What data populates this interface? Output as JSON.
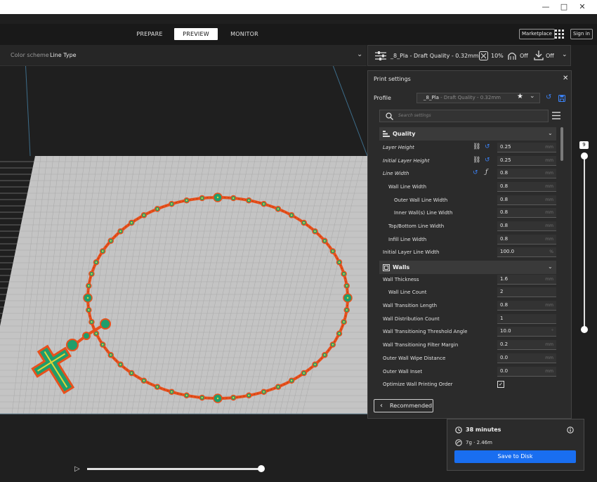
{
  "window": {
    "minimize": "—",
    "maximize": "□",
    "close": "✕"
  },
  "stages": [
    {
      "label": "PREPARE",
      "active": false
    },
    {
      "label": "PREVIEW",
      "active": true
    },
    {
      "label": "MONITOR",
      "active": false
    }
  ],
  "header": {
    "marketplace": "Marketplace",
    "signin": "Sign in"
  },
  "color_scheme": {
    "label": "Color scheme",
    "value": "Line Type"
  },
  "print_setup": {
    "profile": "_8_Pla - Draft Quality - 0.32mm",
    "infill": "10%",
    "support": "Off",
    "adhesion": "Off"
  },
  "panel": {
    "title": "Print settings",
    "profile_label": "Profile",
    "profile_name": "_8_Pla",
    "profile_sub": " - Draft Quality - 0.32mm",
    "search_placeholder": "Search settings",
    "recommended": "Recommended"
  },
  "quality": {
    "title": "Quality",
    "rows": [
      {
        "label": "Layer Height",
        "value": "0.25",
        "unit": "mm"
      },
      {
        "label": "Initial Layer Height",
        "value": "0.25",
        "unit": "mm"
      },
      {
        "label": "Line Width",
        "value": "0.8",
        "unit": "mm"
      },
      {
        "label": "Wall Line Width",
        "value": "0.8",
        "unit": "mm"
      },
      {
        "label": "Outer Wall Line Width",
        "value": "0.8",
        "unit": "mm"
      },
      {
        "label": "Inner Wall(s) Line Width",
        "value": "0.8",
        "unit": "mm"
      },
      {
        "label": "Top/Bottom Line Width",
        "value": "0.8",
        "unit": "mm"
      },
      {
        "label": "Infill Line Width",
        "value": "0.8",
        "unit": "mm"
      },
      {
        "label": "Initial Layer Line Width",
        "value": "100.0",
        "unit": "%"
      }
    ]
  },
  "walls": {
    "title": "Walls",
    "rows": [
      {
        "label": "Wall Thickness",
        "value": "1.6",
        "unit": "mm"
      },
      {
        "label": "Wall Line Count",
        "value": "2",
        "unit": ""
      },
      {
        "label": "Wall Transition Length",
        "value": "0.8",
        "unit": "mm"
      },
      {
        "label": "Wall Distribution Count",
        "value": "1",
        "unit": ""
      },
      {
        "label": "Wall Transitioning Threshold Angle",
        "value": "10.0",
        "unit": "°"
      },
      {
        "label": "Wall Transitioning Filter Margin",
        "value": "0.2",
        "unit": "mm"
      },
      {
        "label": "Outer Wall Wipe Distance",
        "value": "0.0",
        "unit": "mm"
      },
      {
        "label": "Outer Wall Inset",
        "value": "0.0",
        "unit": "mm"
      },
      {
        "label": "Optimize Wall Printing Order",
        "checked": true,
        "mark": "✓"
      }
    ]
  },
  "layer_view": {
    "current_layer": "9",
    "layer_progress": 1.0,
    "path_progress": 1.0
  },
  "job": {
    "time": "38 minutes",
    "material": "7g · 2.46m",
    "save": "Save to Disk"
  },
  "colors": {
    "accent": "#196ef0",
    "outer_wall": "#e8501c",
    "inner_wall": "#1f9e6b",
    "infill": "#e3d23a",
    "plate": "#c4c4c4"
  }
}
